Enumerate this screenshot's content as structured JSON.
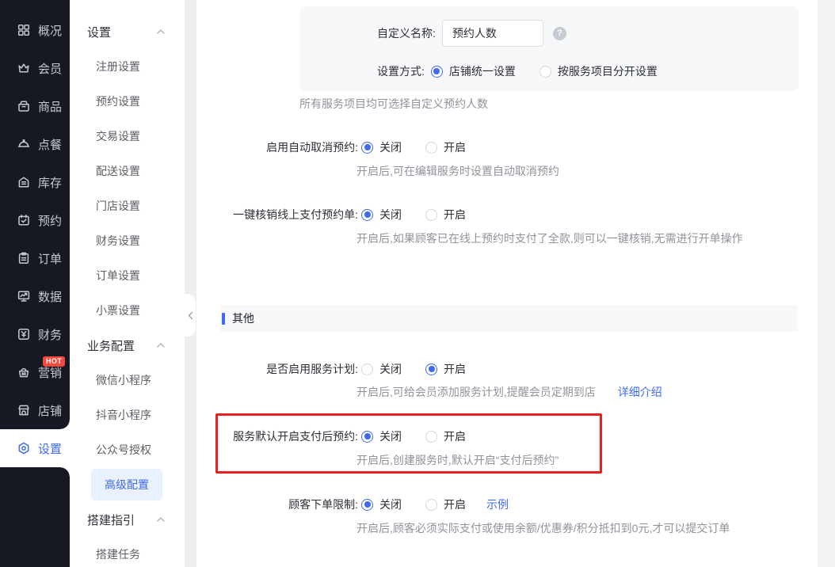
{
  "colors": {
    "accent": "#3e68f6",
    "sidebar_bg": "#161922",
    "highlight_border": "#ea2020",
    "badge_bg": "#f5483f",
    "panel_bg": "#f7f8fa"
  },
  "sidebar": {
    "items": [
      {
        "label": "概况",
        "icon": "grid-icon"
      },
      {
        "label": "会员",
        "icon": "crown-icon"
      },
      {
        "label": "商品",
        "icon": "goods-box-icon"
      },
      {
        "label": "点餐",
        "icon": "dish-cloche-icon"
      },
      {
        "label": "库存",
        "icon": "warehouse-icon"
      },
      {
        "label": "预约",
        "icon": "calendar-check-icon"
      },
      {
        "label": "订单",
        "icon": "clipboard-icon"
      },
      {
        "label": "数据",
        "icon": "monitor-chart-icon"
      },
      {
        "label": "财务",
        "icon": "yen-square-icon"
      },
      {
        "label": "营销",
        "icon": "basket-icon",
        "badge": "HOT"
      },
      {
        "label": "店铺",
        "icon": "storefront-icon"
      },
      {
        "label": "设置",
        "icon": "gear-icon",
        "active": true
      }
    ]
  },
  "submenu": {
    "groups": [
      {
        "title": "设置",
        "expanded": true,
        "items": [
          "注册设置",
          "预约设置",
          "交易设置",
          "配送设置",
          "门店设置",
          "财务设置",
          "订单设置",
          "小票设置"
        ]
      },
      {
        "title": "业务配置",
        "expanded": true,
        "items": [
          "微信小程序",
          "抖音小程序",
          "公众号授权",
          "高级配置"
        ],
        "active_item": "高级配置"
      },
      {
        "title": "搭建指引",
        "expanded": true,
        "items": [
          "搭建任务"
        ]
      }
    ]
  },
  "content": {
    "panel": {
      "name_label": "自定义名称:",
      "name_value": "预约人数",
      "mode_label": "设置方式:",
      "mode_options": [
        {
          "label": "店铺统一设置",
          "selected": true
        },
        {
          "label": "按服务项目分开设置",
          "selected": false
        }
      ]
    },
    "panel_note": "所有服务项目均可选择自定义预约人数",
    "section_title": "其他",
    "rows": [
      {
        "label": "启用自动取消预约:",
        "off": "关闭",
        "on": "开启",
        "selected": "off",
        "helper": "开启后,可在编辑服务时设置自动取消预约"
      },
      {
        "label": "一键核销线上支付预约单:",
        "off": "关闭",
        "on": "开启",
        "selected": "off",
        "helper": "开启后,如果顾客已在线上预约时支付了全款,则可以一键核销,无需进行开单操作"
      },
      {
        "label": "是否启用服务计划:",
        "off": "关闭",
        "on": "开启",
        "selected": "on",
        "helper": "开启后,可给会员添加服务计划,提醒会员定期到店",
        "link": "详细介绍"
      },
      {
        "label": "服务默认开启支付后预约:",
        "off": "关闭",
        "on": "开启",
        "selected": "off",
        "helper": "开启后,创建服务时,默认开启“支付后预约”",
        "highlighted": true
      },
      {
        "label": "顾客下单限制:",
        "off": "关闭",
        "on": "开启",
        "selected": "off",
        "inline_link": "示例",
        "helper": "开启后,顾客必须实际支付或使用余额/优惠券/积分抵扣到0元,才可以提交订单"
      }
    ]
  }
}
